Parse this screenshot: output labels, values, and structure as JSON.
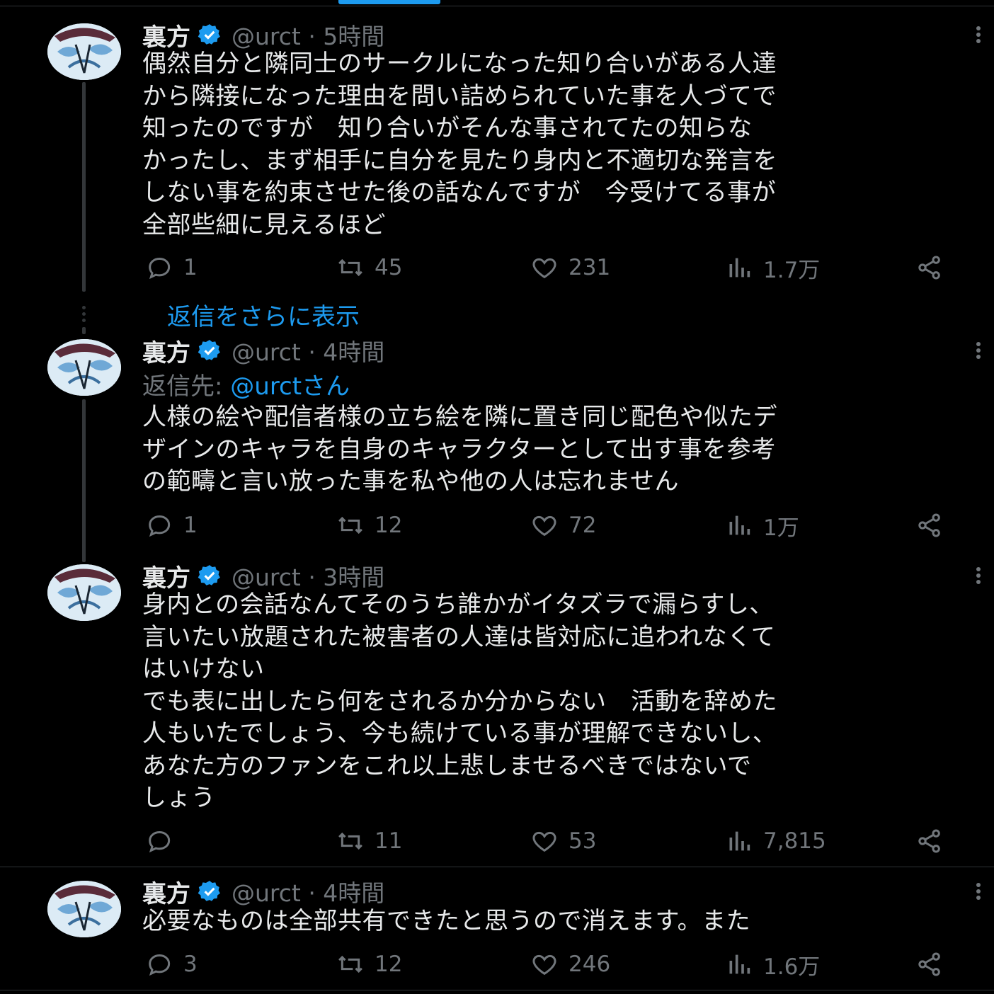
{
  "tweets": [
    {
      "name": "裏方",
      "handle": "@urct · 5時間",
      "text": "偶然自分と隣同士のサークルになった知り合いがある人達\nから隣接になった理由を問い詰められていた事を人づてで\n知ったのですが　知り合いがそんな事されてたの知らな\nかったし、まず相手に自分を見たり身内と不適切な発言を\nしない事を約束させた後の話なんですが　今受けてる事が\n全部些細に見えるほど",
      "replies": "1",
      "retweets": "45",
      "likes": "231",
      "views": "1.7万"
    },
    {
      "name": "裏方",
      "handle": "@urct · 4時間",
      "reply_prefix": "返信先: ",
      "reply_link": "@urctさん",
      "text": "人様の絵や配信者様の立ち絵を隣に置き同じ配色や似たデ\nザインのキャラを自身のキャラクターとして出す事を参考\nの範疇と言い放った事を私や他の人は忘れません",
      "replies": "1",
      "retweets": "12",
      "likes": "72",
      "views": "1万"
    },
    {
      "name": "裏方",
      "handle": "@urct · 3時間",
      "text": "身内との会話なんてそのうち誰かがイタズラで漏らすし、\n言いたい放題された被害者の人達は皆対応に追われなくて\nはいけない\nでも表に出したら何をされるか分からない　活動を辞めた\n人もいたでしょう、今も続けている事が理解できないし、\nあなた方のファンをこれ以上悲しませるべきではないで\nしょう",
      "replies": "",
      "retweets": "11",
      "likes": "53",
      "views": "7,815"
    },
    {
      "name": "裏方",
      "handle": "@urct · 4時間",
      "text": "必要なものは全部共有できたと思うので消えます。また",
      "replies": "3",
      "retweets": "12",
      "likes": "246",
      "views": "1.6万"
    }
  ],
  "show_more_replies": "返信をさらに表示",
  "colors": {
    "accent": "#1d9bf0",
    "muted": "#71767b",
    "text": "#e7e9ea",
    "background": "#000000"
  }
}
